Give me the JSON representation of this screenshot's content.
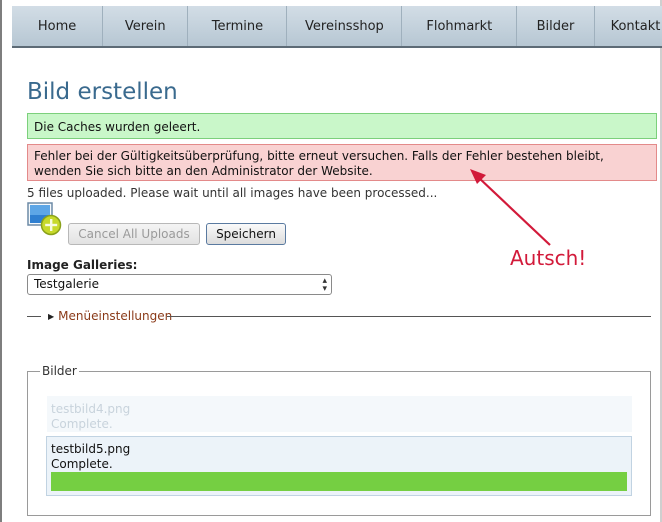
{
  "nav": {
    "items": [
      "Home",
      "Verein",
      "Termine",
      "Vereinsshop",
      "Flohmarkt",
      "Bilder",
      "Kontakt"
    ]
  },
  "page": {
    "title": "Bild erstellen"
  },
  "messages": {
    "success": "Die Caches wurden geleert.",
    "error": "Fehler bei der Gültigkeitsüberprüfung, bitte erneut versuchen. Falls der Fehler bestehen bleibt, wenden Sie sich bitte an den Administrator der Website."
  },
  "upload": {
    "status": "5 files uploaded. Please wait until all images have been processed...",
    "cancel_label": "Cancel All Uploads",
    "save_label": "Speichern"
  },
  "annotation": {
    "text": "Autsch!",
    "color": "#d21a3a"
  },
  "galleries": {
    "label": "Image Galleries:",
    "selected": "Testgalerie"
  },
  "menu_settings": {
    "label": "Menüeinstellungen"
  },
  "images": {
    "legend": "Bilder",
    "files": [
      {
        "name": "testbild4.png",
        "status": "Complete."
      },
      {
        "name": "testbild5.png",
        "status": "Complete.",
        "progress": 1.0
      }
    ]
  },
  "colors": {
    "accent": "#3a6a8e",
    "success_bg": "#c9f7c9",
    "error_bg": "#f9d2d2",
    "progress": "#75cf42"
  }
}
